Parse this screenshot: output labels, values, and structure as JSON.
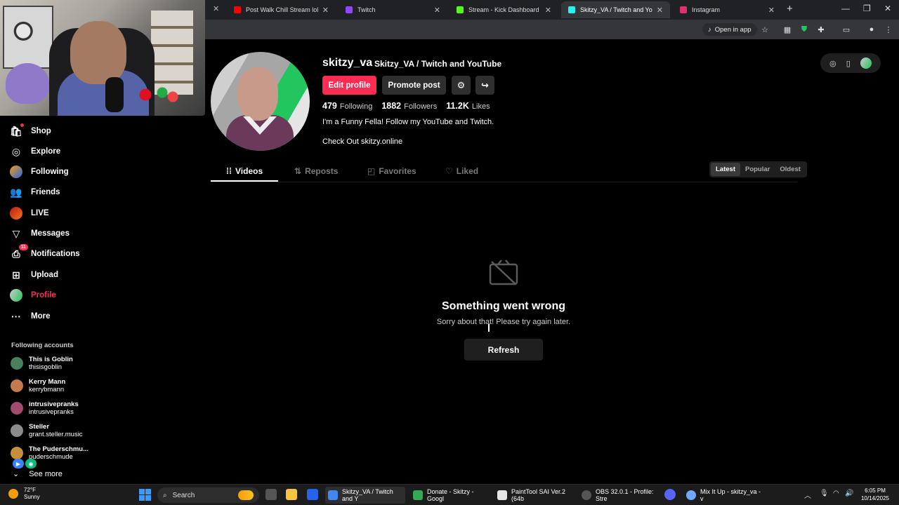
{
  "browser": {
    "tabs": [
      {
        "title": "Post Walk Chill Stream lol - You",
        "color": "#ff0000"
      },
      {
        "title": "Twitch",
        "color": "#9146ff"
      },
      {
        "title": "Stream - Kick Dashboard",
        "color": "#53fc18"
      },
      {
        "title": "Skitzy_VA / Twitch and YouTube",
        "color": "#25f4ee"
      },
      {
        "title": "Instagram",
        "color": "#e1306c"
      }
    ],
    "open_in_app": "Open in app"
  },
  "sidebar": {
    "items": [
      {
        "label": "Shop",
        "icon": "shop-icon"
      },
      {
        "label": "Explore",
        "icon": "compass-icon"
      },
      {
        "label": "Following",
        "icon": "following-avatar-icon"
      },
      {
        "label": "Friends",
        "icon": "friends-icon"
      },
      {
        "label": "LIVE",
        "icon": "live-avatar-icon"
      },
      {
        "label": "Messages",
        "icon": "messages-icon"
      },
      {
        "label": "Notifications",
        "icon": "notifications-icon",
        "badge": "11"
      },
      {
        "label": "Upload",
        "icon": "upload-icon"
      },
      {
        "label": "Profile",
        "icon": "profile-avatar-icon"
      },
      {
        "label": "More",
        "icon": "more-icon"
      }
    ],
    "following_title": "Following accounts",
    "accounts": [
      {
        "name": "This is Goblin",
        "handle": "thisisgoblin",
        "color": "#4a7f5c"
      },
      {
        "name": "Kerry Mann",
        "handle": "kerrybmann",
        "color": "#c47a4d"
      },
      {
        "name": "intrusivepranks",
        "handle": "intrusivepranks",
        "color": "#a24b6f"
      },
      {
        "name": "Steller",
        "handle": "grant.steller.music",
        "color": "#8b8b8b"
      },
      {
        "name": "The Puderschmu...",
        "handle": "puderschmude",
        "color": "#c58f3b"
      }
    ],
    "see_more": "See more"
  },
  "profile": {
    "username": "skitzy_va",
    "display_name": "Skitzy_VA / Twitch and YouTube",
    "edit_label": "Edit profile",
    "promote_label": "Promote post",
    "following_count": "479",
    "following_label": "Following",
    "followers_count": "1882",
    "followers_label": "Followers",
    "likes_count": "11.2K",
    "likes_label": "Likes",
    "bio": "I'm a Funny Fella! Follow my YouTube and Twitch.",
    "link": "Check Out skitzy.online"
  },
  "tabs": {
    "videos": "Videos",
    "reposts": "Reposts",
    "favorites": "Favorites",
    "liked": "Liked"
  },
  "sort": {
    "latest": "Latest",
    "popular": "Popular",
    "oldest": "Oldest"
  },
  "empty_state": {
    "title": "Something went wrong",
    "subtitle": "Sorry about that! Please try again later.",
    "refresh": "Refresh"
  },
  "taskbar": {
    "temp": "72°F",
    "weather": "Sunny",
    "search": "Search",
    "apps": [
      {
        "label": "Skitzy_VA / Twitch and Y",
        "color": "#4285f4"
      },
      {
        "label": "Donate - Skitzy - Googl",
        "color": "#34a853"
      },
      {
        "label": "PaintTool SAI Ver.2 (64b",
        "color": "#e5e5e5"
      },
      {
        "label": "OBS 32.0.1 - Profile: Stre",
        "color": "#555555"
      },
      {
        "label": "Mix It Up - skitzy_va - v",
        "color": "#6ea8ff"
      }
    ],
    "time": "6:05 PM",
    "date": "10/14/2025"
  },
  "colors": {
    "accent": "#fe2c55",
    "background": "#000000"
  }
}
